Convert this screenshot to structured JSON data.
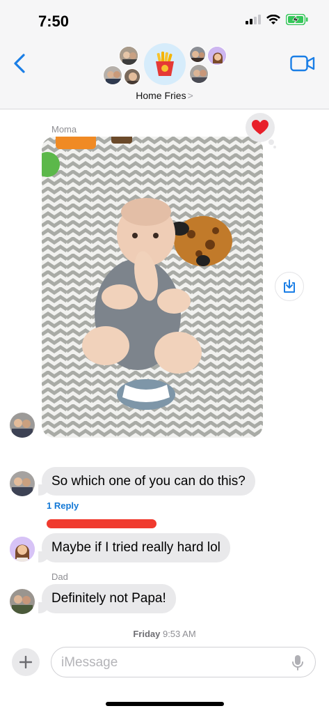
{
  "status_bar": {
    "time": "7:50",
    "icons": [
      "cellular-signal-icon",
      "wifi-icon",
      "battery-charging-icon"
    ]
  },
  "header": {
    "back_icon": "chevron-left-icon",
    "video_icon": "video-camera-icon",
    "group_icon": "french-fries-icon",
    "group_name": "Home Fries",
    "group_name_chevron": ">"
  },
  "messages": [
    {
      "type": "image",
      "sender": "Moma",
      "tapback": "heart",
      "save_icon": "save-to-photos-icon"
    },
    {
      "type": "text",
      "text": "So which one of you can do this?",
      "replies": "1 Reply"
    },
    {
      "type": "text",
      "text": "Maybe if I tried really hard lol"
    },
    {
      "type": "text",
      "sender": "Dad",
      "text": "Definitely not Papa!"
    }
  ],
  "timestamp": {
    "day": "Friday",
    "time": "9:53 AM"
  },
  "composer": {
    "placeholder": "iMessage",
    "plus_icon": "plus-icon",
    "mic_icon": "microphone-icon"
  },
  "colors": {
    "accent": "#1a7ee6",
    "bubble": "#e9e9eb",
    "heart": "#e8202a",
    "redaction": "#f03a2e"
  }
}
